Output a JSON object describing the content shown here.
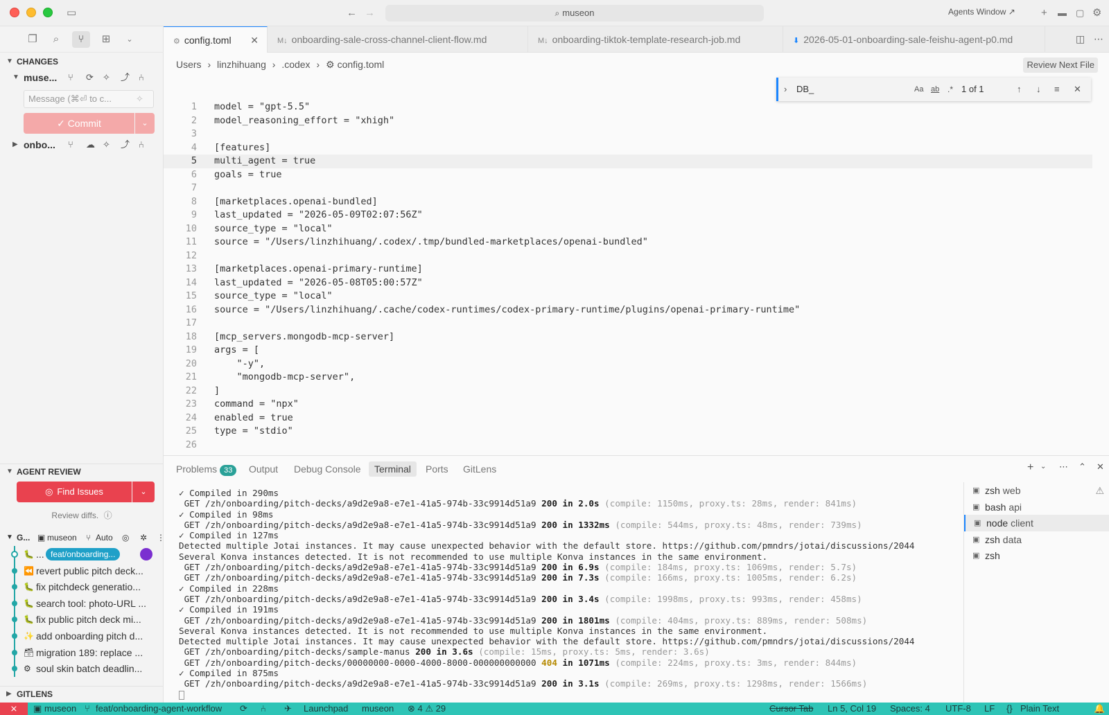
{
  "titlebar": {
    "search": "museon",
    "agents_window": "Agents Window ↗"
  },
  "sidebar": {
    "changes_header": "CHANGES",
    "repo1": "muse...",
    "commit_placeholder": "Message (⌘⏎ to c...",
    "commit_label": "✓ Commit",
    "repo2": "onbo...",
    "agent_review_header": "AGENT REVIEW",
    "find_issues": "Find Issues",
    "review_diffs": "Review diffs.",
    "graph_header": {
      "label": "G...",
      "repo": "museon",
      "branch_mode": "Auto"
    },
    "graph": [
      {
        "icon": "🐛",
        "text": "...",
        "branch": "feat/onboarding..."
      },
      {
        "icon": "⏪",
        "text": "revert public pitch deck..."
      },
      {
        "icon": "🐛",
        "text": "fix pitchdeck generatio..."
      },
      {
        "icon": "🐛",
        "text": "search tool: photo-URL ..."
      },
      {
        "icon": "🐛",
        "text": "fix public pitch deck mi..."
      },
      {
        "icon": "✨",
        "text": "add onboarding pitch d..."
      },
      {
        "icon": "🗃",
        "text": "migration 189: replace ..."
      },
      {
        "icon": "⚙",
        "text": "soul  skin batch deadlin..."
      }
    ],
    "gitlens_header": "GITLENS"
  },
  "tabs": [
    {
      "label": "config.toml",
      "icon": "⚙"
    },
    {
      "label": "onboarding-sale-cross-channel-client-flow.md",
      "icon": "M↓"
    },
    {
      "label": "onboarding-tiktok-template-research-job.md",
      "icon": "M↓"
    },
    {
      "label": "2026-05-01-onboarding-sale-feishu-agent-p0.md",
      "icon": "⬇"
    }
  ],
  "breadcrumb": {
    "p1": "Users",
    "p2": "linzhihuang",
    "p3": ".codex",
    "p4": "config.toml",
    "review_next": "Review Next File"
  },
  "find": {
    "query": "DB_",
    "opt_case": "Aa",
    "opt_word": "ab",
    "opt_regex": ".*",
    "result": "1 of 1"
  },
  "code": [
    "model = \"gpt-5.5\"",
    "model_reasoning_effort = \"xhigh\"",
    "",
    "[features]",
    "multi_agent = true",
    "goals = true",
    "",
    "[marketplaces.openai-bundled]",
    "last_updated = \"2026-05-09T02:07:56Z\"",
    "source_type = \"local\"",
    "source = \"/Users/linzhihuang/.codex/.tmp/bundled-marketplaces/openai-bundled\"",
    "",
    "[marketplaces.openai-primary-runtime]",
    "last_updated = \"2026-05-08T05:00:57Z\"",
    "source_type = \"local\"",
    "source = \"/Users/linzhihuang/.cache/codex-runtimes/codex-primary-runtime/plugins/openai-primary-runtime\"",
    "",
    "[mcp_servers.mongodb-mcp-server]",
    "args = [",
    "    \"-y\",",
    "    \"mongodb-mcp-server\",",
    "]",
    "command = \"npx\"",
    "enabled = true",
    "type = \"stdio\"",
    ""
  ],
  "line_numbers": [
    "1",
    "2",
    "3",
    "4",
    "5",
    "6",
    "7",
    "8",
    "9",
    "10",
    "11",
    "12",
    "13",
    "14",
    "15",
    "16",
    "17",
    "18",
    "19",
    "20",
    "21",
    "22",
    "23",
    "24",
    "25",
    "26"
  ],
  "panel": {
    "tabs": [
      "Problems",
      "Output",
      "Debug Console",
      "Terminal",
      "Ports",
      "GitLens"
    ],
    "problems_count": "33",
    "terminal_lines": [
      {
        "kind": "compiled",
        "text": "✓ Compiled in 290ms"
      },
      {
        "kind": "get",
        "path": " GET /zh/onboarding/pitch-decks/a9d2e9a8-e7e1-41a5-974b-33c9914d51a9 ",
        "status": "200",
        "time": " in 2.0s ",
        "detail": "(compile: 1150ms, proxy.ts: 28ms, render: 841ms)"
      },
      {
        "kind": "compiled",
        "text": "✓ Compiled in 98ms"
      },
      {
        "kind": "get",
        "path": " GET /zh/onboarding/pitch-decks/a9d2e9a8-e7e1-41a5-974b-33c9914d51a9 ",
        "status": "200",
        "time": " in 1332ms ",
        "detail": "(compile: 544ms, proxy.ts: 48ms, render: 739ms)"
      },
      {
        "kind": "compiled",
        "text": "✓ Compiled in 127ms"
      },
      {
        "kind": "plain",
        "text": "Detected multiple Jotai instances. It may cause unexpected behavior with the default store. https://github.com/pmndrs/jotai/discussions/2044"
      },
      {
        "kind": "plain",
        "text": "Several Konva instances detected. It is not recommended to use multiple Konva instances in the same environment."
      },
      {
        "kind": "get",
        "path": " GET /zh/onboarding/pitch-decks/a9d2e9a8-e7e1-41a5-974b-33c9914d51a9 ",
        "status": "200",
        "time": " in 6.9s ",
        "detail": "(compile: 184ms, proxy.ts: 1069ms, render: 5.7s)"
      },
      {
        "kind": "get",
        "path": " GET /zh/onboarding/pitch-decks/a9d2e9a8-e7e1-41a5-974b-33c9914d51a9 ",
        "status": "200",
        "time": " in 7.3s ",
        "detail": "(compile: 166ms, proxy.ts: 1005ms, render: 6.2s)"
      },
      {
        "kind": "compiled",
        "text": "✓ Compiled in 228ms"
      },
      {
        "kind": "get",
        "path": " GET /zh/onboarding/pitch-decks/a9d2e9a8-e7e1-41a5-974b-33c9914d51a9 ",
        "status": "200",
        "time": " in 3.4s ",
        "detail": "(compile: 1998ms, proxy.ts: 993ms, render: 458ms)"
      },
      {
        "kind": "compiled",
        "text": "✓ Compiled in 191ms"
      },
      {
        "kind": "get",
        "path": " GET /zh/onboarding/pitch-decks/a9d2e9a8-e7e1-41a5-974b-33c9914d51a9 ",
        "status": "200",
        "time": " in 1801ms ",
        "detail": "(compile: 404ms, proxy.ts: 889ms, render: 508ms)"
      },
      {
        "kind": "plain",
        "text": "Several Konva instances detected. It is not recommended to use multiple Konva instances in the same environment."
      },
      {
        "kind": "plain",
        "text": "Detected multiple Jotai instances. It may cause unexpected behavior with the default store. https://github.com/pmndrs/jotai/discussions/2044"
      },
      {
        "kind": "get",
        "path": " GET /zh/onboarding/pitch-decks/sample-manus ",
        "status": "200",
        "time": " in 3.6s ",
        "detail": "(compile: 15ms, proxy.ts: 5ms, render: 3.6s)"
      },
      {
        "kind": "get404",
        "path": " GET /zh/onboarding/pitch-decks/00000000-0000-4000-8000-000000000000 ",
        "status": "404",
        "time": " in 1071ms ",
        "detail": "(compile: 224ms, proxy.ts: 3ms, render: 844ms)"
      },
      {
        "kind": "compiled",
        "text": "✓ Compiled in 875ms"
      },
      {
        "kind": "get",
        "path": " GET /zh/onboarding/pitch-decks/a9d2e9a8-e7e1-41a5-974b-33c9914d51a9 ",
        "status": "200",
        "time": " in 3.1s ",
        "detail": "(compile: 269ms, proxy.ts: 1298ms, render: 1566ms)"
      }
    ],
    "terminals": [
      {
        "name": "zsh",
        "sub": "web"
      },
      {
        "name": "bash",
        "sub": "api"
      },
      {
        "name": "node",
        "sub": "client"
      },
      {
        "name": "zsh",
        "sub": "data"
      },
      {
        "name": "zsh",
        "sub": ""
      }
    ]
  },
  "statusbar": {
    "repo": "museon",
    "branch": "feat/onboarding-agent-workflow",
    "launchpad": "Launchpad",
    "user": "museon",
    "errors": "4",
    "warnings": "29",
    "cursor_tab": "Cursor Tab",
    "position": "Ln 5, Col 19",
    "spaces": "Spaces: 4",
    "encoding": "UTF-8",
    "eol": "LF",
    "language": "Plain Text"
  },
  "colors": {
    "accent": "#1a85ff",
    "status_bar": "#2ec4b6",
    "danger": "#e9424f",
    "commit_disabled": "#f4a9a9"
  }
}
